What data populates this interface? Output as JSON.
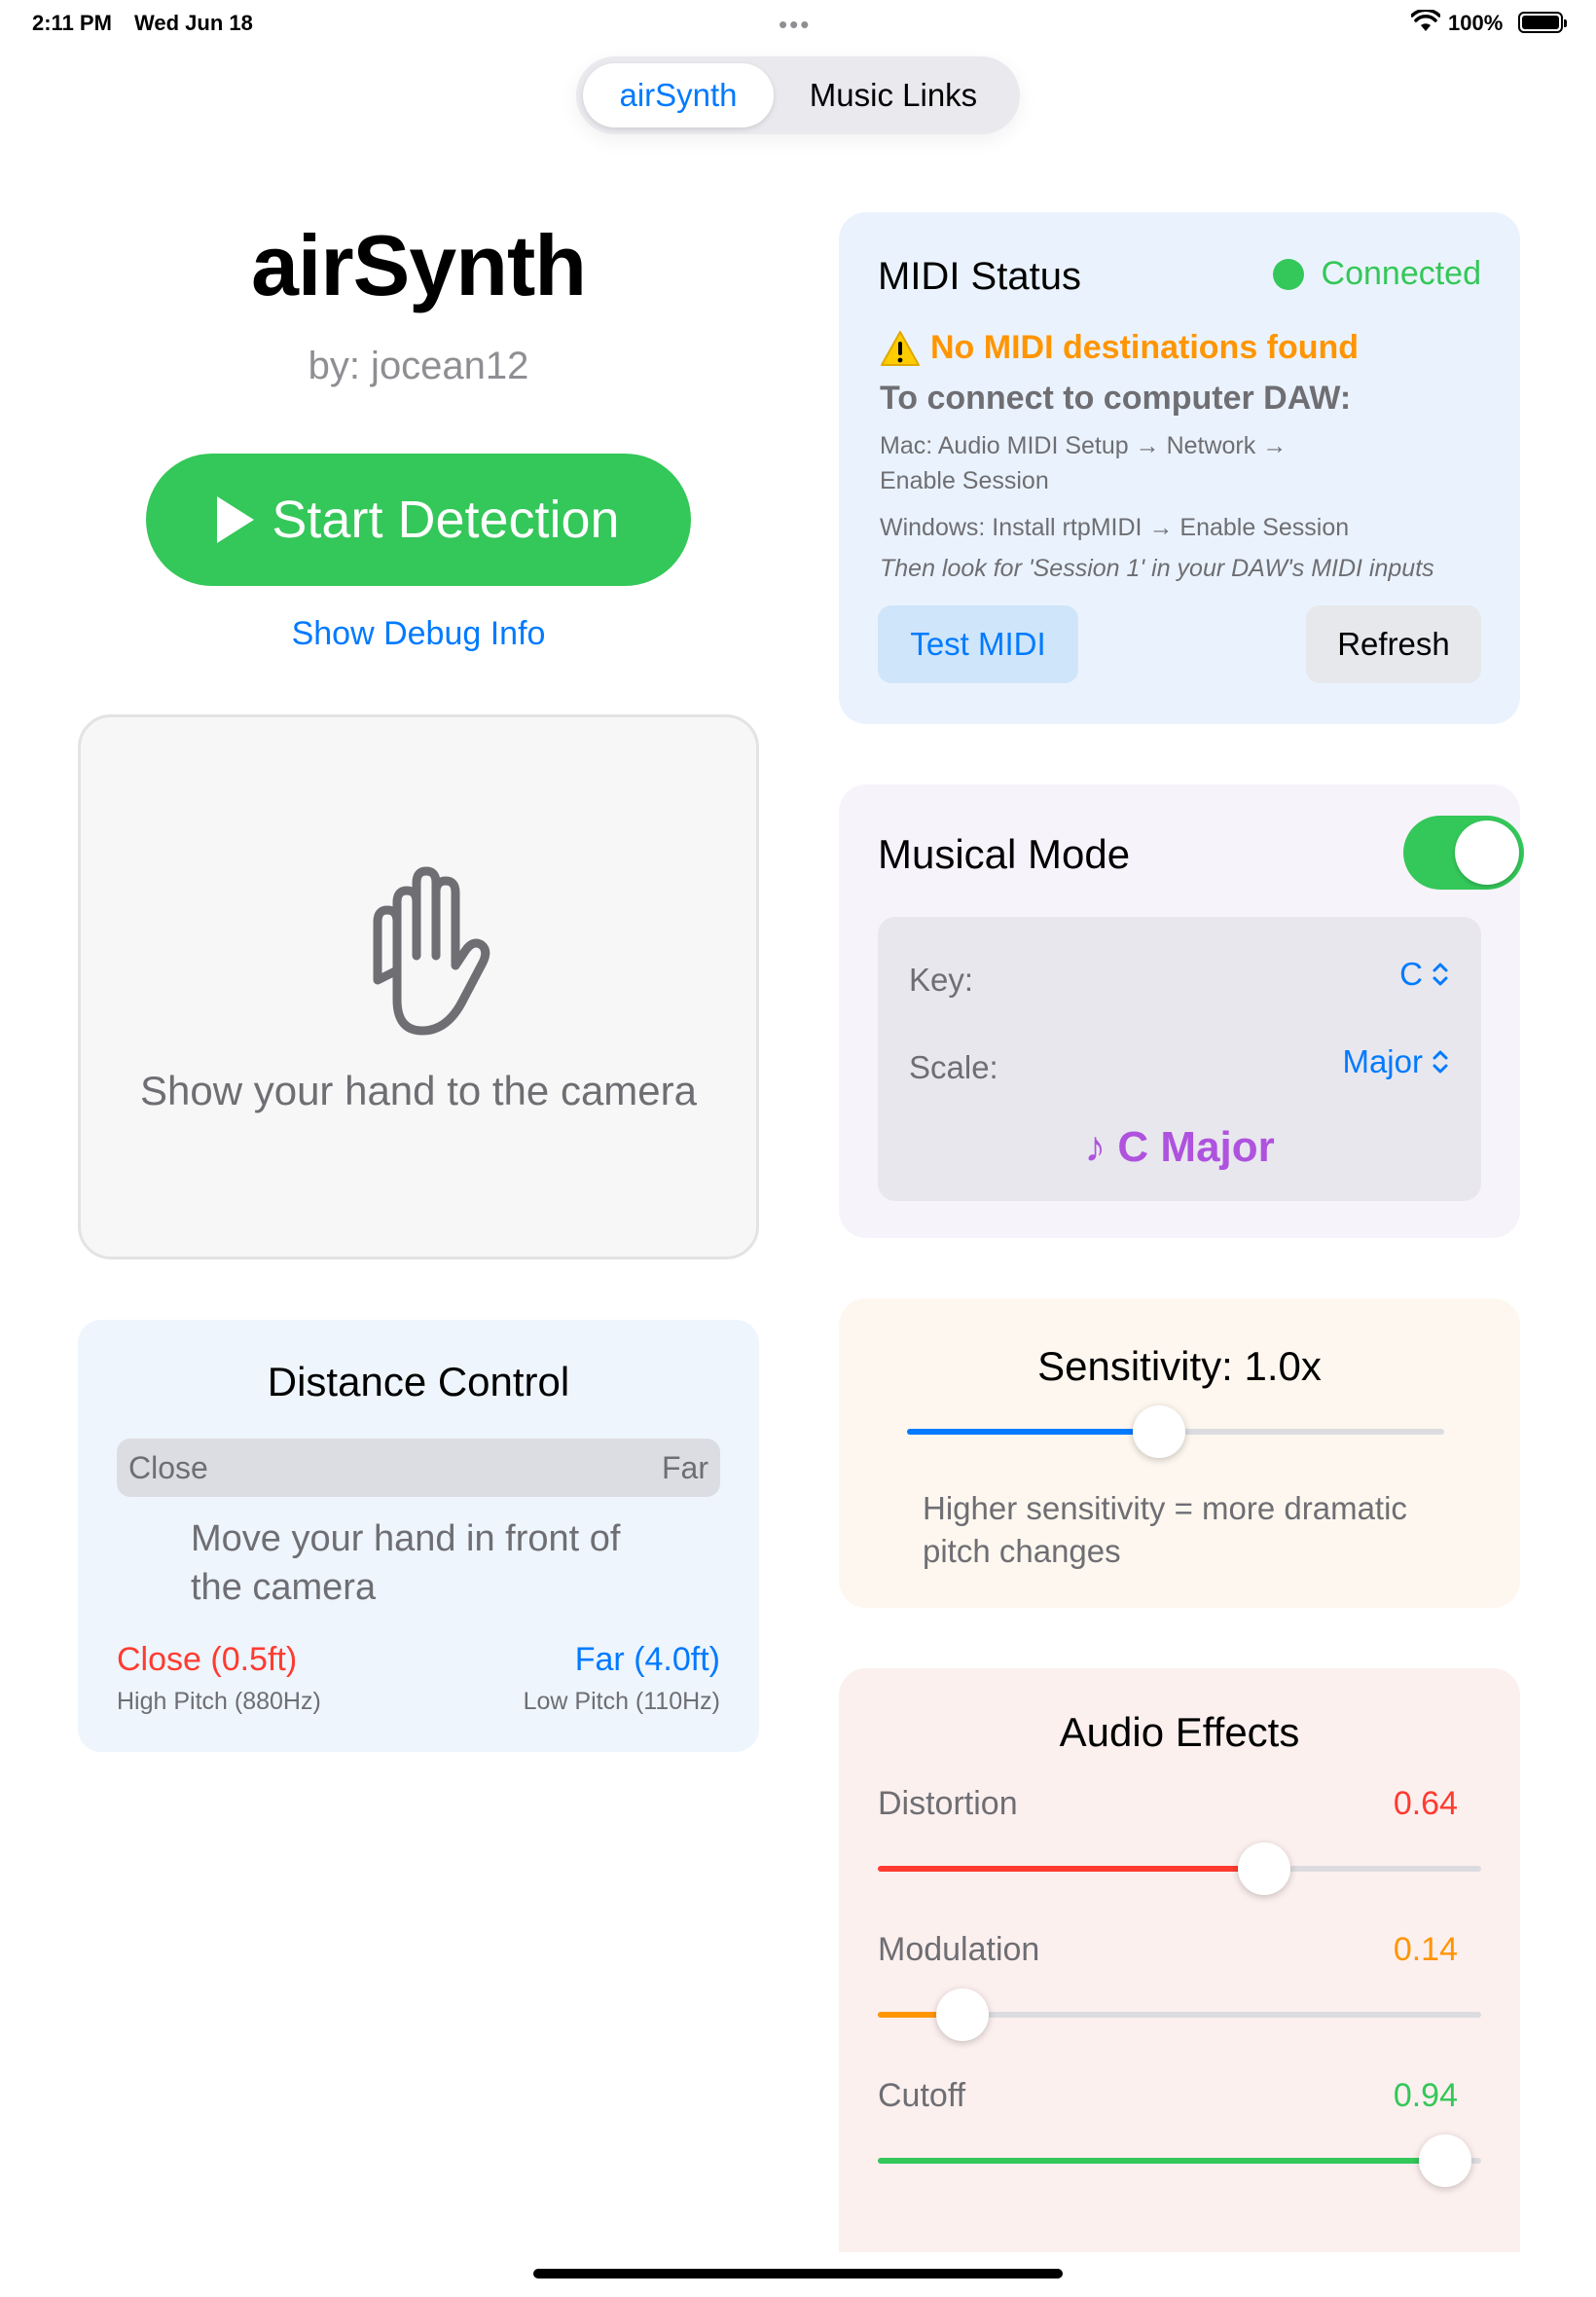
{
  "status_bar": {
    "time": "2:11 PM",
    "date": "Wed Jun 18",
    "battery": "100%"
  },
  "tabs": [
    {
      "label": "airSynth",
      "active": true
    },
    {
      "label": "Music Links",
      "active": false
    }
  ],
  "header": {
    "title": "airSynth",
    "author": "by: jocean12",
    "start_button": "Start Detection",
    "debug_link": "Show Debug Info"
  },
  "camera": {
    "message": "Show your hand to the camera",
    "icon": "hand-raised-icon"
  },
  "distance": {
    "title": "Distance Control",
    "bar_left": "Close",
    "bar_right": "Far",
    "message": "Move your hand in front of the camera",
    "close_label": "Close (0.5ft)",
    "close_sub": "High Pitch (880Hz)",
    "far_label": "Far (4.0ft)",
    "far_sub": "Low Pitch (110Hz)"
  },
  "midi": {
    "title": "MIDI Status",
    "status": "Connected",
    "warning": "No MIDI destinations found",
    "connect_heading": "To connect to computer DAW:",
    "mac_line1": "Mac: Audio MIDI Setup → Network →",
    "mac_line2": "Enable Session",
    "windows_line": "Windows: Install rtpMIDI → Enable Session",
    "then_line": "Then look for 'Session 1' in your DAW's MIDI inputs",
    "test_button": "Test MIDI",
    "refresh_button": "Refresh"
  },
  "musical_mode": {
    "title": "Musical Mode",
    "enabled": true,
    "key_label": "Key:",
    "key_value": "C",
    "scale_label": "Scale:",
    "scale_value": "Major",
    "result": "♪ C Major"
  },
  "sensitivity": {
    "title": "Sensitivity: 1.0x",
    "level": 0.47,
    "description": "Higher sensitivity = more dramatic pitch changes"
  },
  "effects": {
    "title": "Audio Effects",
    "items": [
      {
        "label": "Distortion",
        "value": "0.64",
        "level": 0.64,
        "color": "#ff3b30"
      },
      {
        "label": "Modulation",
        "value": "0.14",
        "level": 0.14,
        "color": "#ff9500"
      },
      {
        "label": "Cutoff",
        "value": "0.94",
        "level": 0.94,
        "color": "#34c759"
      }
    ]
  },
  "colors": {
    "accent": "#007aff",
    "green": "#34c759",
    "purple": "#af52de",
    "orange": "#ff9500",
    "red": "#ff3b30"
  }
}
